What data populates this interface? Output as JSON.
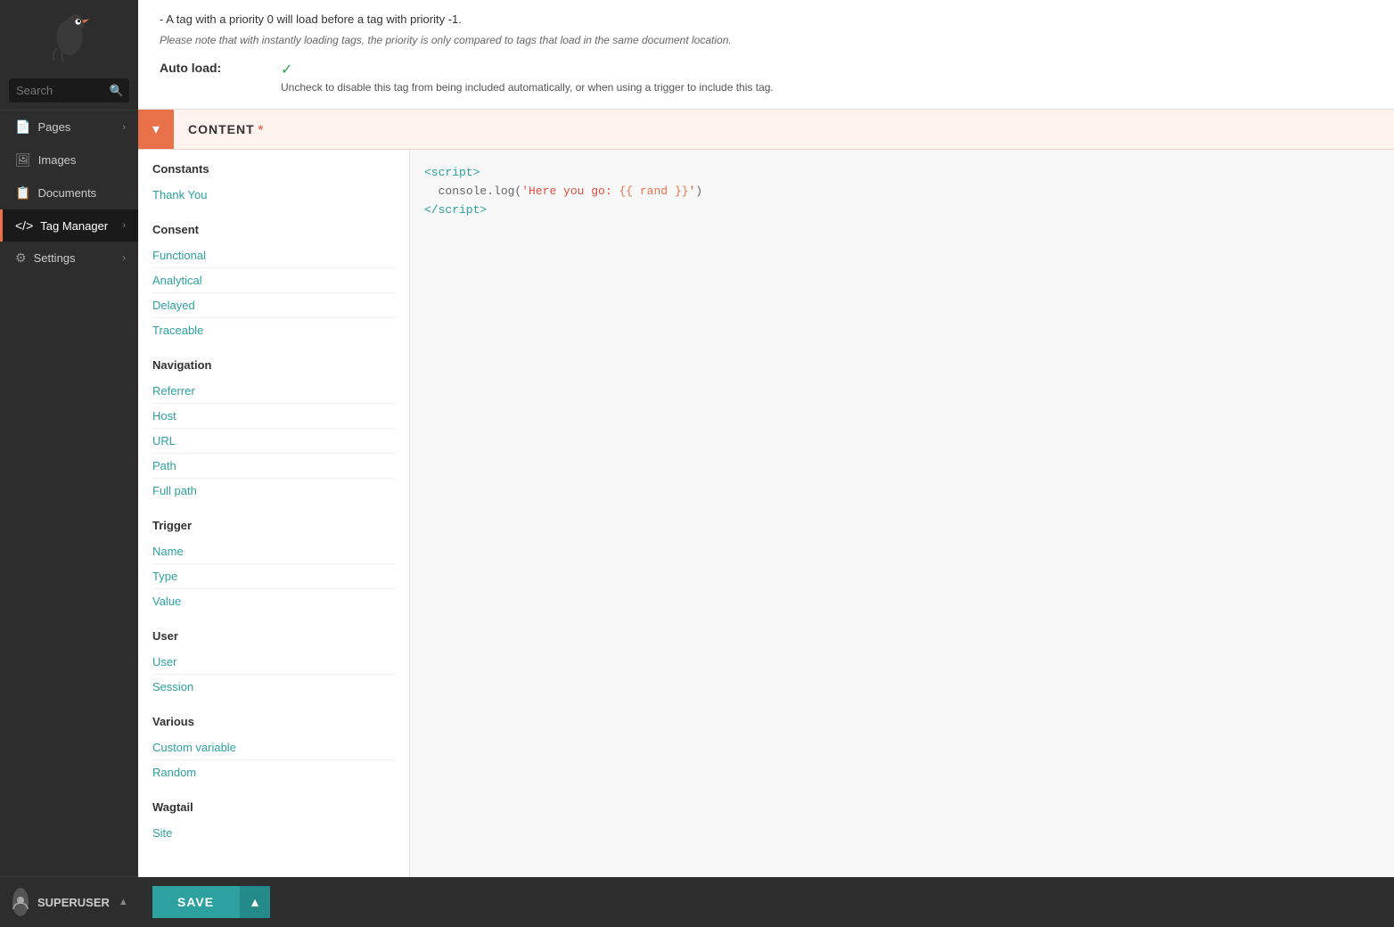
{
  "sidebar": {
    "logo_alt": "Wagtail bird logo",
    "search_placeholder": "Search",
    "items": [
      {
        "id": "pages",
        "label": "Pages",
        "icon": "📄",
        "has_arrow": true,
        "active": false
      },
      {
        "id": "images",
        "label": "Images",
        "icon": "🖼",
        "has_arrow": false,
        "active": false
      },
      {
        "id": "documents",
        "label": "Documents",
        "icon": "📋",
        "has_arrow": false,
        "active": false
      },
      {
        "id": "tag-manager",
        "label": "Tag Manager",
        "icon": "</>",
        "has_arrow": true,
        "active": true
      },
      {
        "id": "settings",
        "label": "Settings",
        "icon": "⚙",
        "has_arrow": true,
        "active": false
      }
    ],
    "footer": {
      "user": "SUPERUSER",
      "chevron": "▲"
    }
  },
  "top_section": {
    "priority_line": "- A tag with a priority 0 will load before a tag with priority -1.",
    "priority_note": "Please note that with instantly loading tags, the priority is only compared to tags that load in the same document location.",
    "auto_load_label": "Auto load:",
    "auto_load_desc": "Uncheck to disable this tag from being included automatically, or when using a trigger to include this tag.",
    "checkmark": "✓"
  },
  "content_section": {
    "title": "CONTENT",
    "required_indicator": "*",
    "collapse_icon": "▾"
  },
  "variables": {
    "constants": {
      "title": "Constants",
      "items": [
        "Thank You"
      ]
    },
    "consent": {
      "title": "Consent",
      "items": [
        "Functional",
        "Analytical",
        "Delayed",
        "Traceable"
      ]
    },
    "navigation": {
      "title": "Navigation",
      "items": [
        "Referrer",
        "Host",
        "URL",
        "Path",
        "Full path"
      ]
    },
    "trigger": {
      "title": "Trigger",
      "items": [
        "Name",
        "Type",
        "Value"
      ]
    },
    "user": {
      "title": "User",
      "items": [
        "User",
        "Session"
      ]
    },
    "various": {
      "title": "Various",
      "items": [
        "Custom variable",
        "Random"
      ]
    },
    "wagtail": {
      "title": "Wagtail",
      "items": [
        "Site"
      ]
    }
  },
  "code_editor": {
    "line1": "<script>",
    "line2": "  console.log('Here you go: {{ rand }}')",
    "line3": "<\\/script>"
  },
  "save_bar": {
    "save_label": "SAVE",
    "expand_icon": "▲"
  }
}
